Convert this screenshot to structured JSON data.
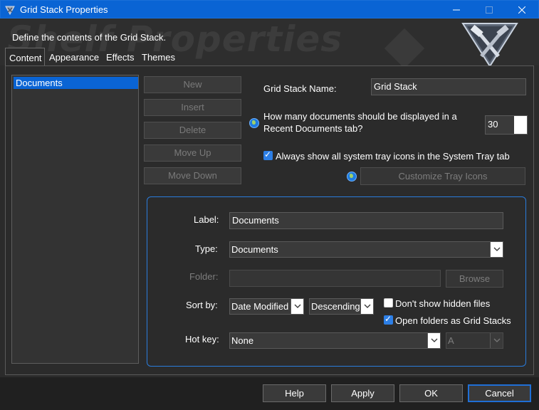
{
  "window": {
    "title": "Grid Stack Properties"
  },
  "header": {
    "description": "Define the contents of the Grid Stack.",
    "watermark": "Shelf Properties"
  },
  "tabs": [
    {
      "label": "Content",
      "active": true
    },
    {
      "label": "Appearance"
    },
    {
      "label": "Effects"
    },
    {
      "label": "Themes"
    }
  ],
  "documents_list": {
    "items": [
      "Documents"
    ],
    "selected": "Documents"
  },
  "list_buttons": {
    "new": "New",
    "insert": "Insert",
    "delete": "Delete",
    "move_up": "Move Up",
    "move_down": "Move Down"
  },
  "grid_stack": {
    "name_label": "Grid Stack Name:",
    "name_value": "Grid Stack",
    "recent_question_line1": "How many documents should be displayed in a",
    "recent_question_line2": "Recent Documents tab?",
    "recent_count": "30",
    "tray_checkbox_label": "Always show all system tray icons in the System Tray tab",
    "tray_checked": true,
    "customize_tray_label": "Customize Tray Icons"
  },
  "item_settings": {
    "label_caption": "Label:",
    "label_value": "Documents",
    "type_caption": "Type:",
    "type_value": "Documents",
    "folder_caption": "Folder:",
    "folder_value": "",
    "browse_label": "Browse",
    "sort_caption": "Sort by:",
    "sort_field": "Date Modified",
    "sort_order": "Descending",
    "hidden_files_label": "Don't show hidden files",
    "hidden_files_checked": false,
    "open_folders_label": "Open folders as Grid Stacks",
    "open_folders_checked": true,
    "hotkey_caption": "Hot key:",
    "hotkey_modifier": "None",
    "hotkey_key": "A"
  },
  "footer": {
    "help": "Help",
    "apply": "Apply",
    "ok": "OK",
    "cancel": "Cancel"
  },
  "colors": {
    "accent": "#0a64d4",
    "background": "#2b2b2b",
    "group_border": "#2a7cdc"
  }
}
